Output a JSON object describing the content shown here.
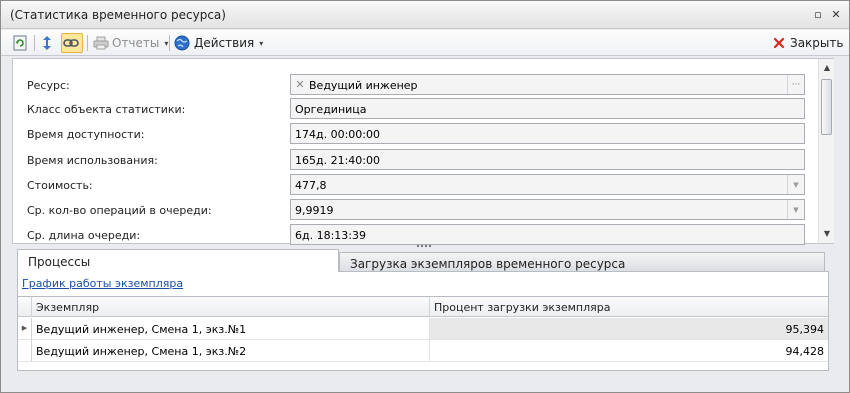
{
  "window": {
    "title": "(Статистика временного ресурса)",
    "restore_glyph": "▫",
    "close_glyph": "✕"
  },
  "toolbar": {
    "reports_label": "Отчеты",
    "actions_label": "Действия",
    "close_label": "Закрыть",
    "caret": "▾"
  },
  "form": {
    "fields": [
      {
        "label": "Ресурс:",
        "value": "Ведущий инженер"
      },
      {
        "label": "Класс объекта статистики:",
        "value": "Оргединица"
      },
      {
        "label": "Время доступности:",
        "value": "174д. 00:00:00"
      },
      {
        "label": "Время использования:",
        "value": "165д. 21:40:00"
      },
      {
        "label": "Стоимость:",
        "value": "477,8"
      },
      {
        "label": "Ср. кол-во операций в очереди:",
        "value": "9,9919"
      },
      {
        "label": "Ср. длина очереди:",
        "value": "6д. 18:13:39"
      }
    ],
    "clear_glyph": "✕",
    "ellipsis": "···",
    "dropdown_glyph": "▼",
    "scroll_up": "▲",
    "scroll_down": "▼"
  },
  "tabs": [
    {
      "label": "Процессы"
    },
    {
      "label": "Загрузка экземпляров временного ресурса"
    }
  ],
  "process_tab": {
    "link_label": "График работы экземпляра",
    "grid": {
      "columns": [
        "Экземпляр",
        "Процент загрузки экземпляра"
      ],
      "row_marker": "▶",
      "rows": [
        {
          "instance": "Ведущий инженер, Смена 1, экз.№1",
          "load": "95,394"
        },
        {
          "instance": "Ведущий инженер, Смена 1, экз.№2",
          "load": "94,428"
        }
      ]
    }
  },
  "colors": {
    "accent": "#ffe79a",
    "link": "#1a4fa5",
    "close_red": "#d42a1f"
  }
}
